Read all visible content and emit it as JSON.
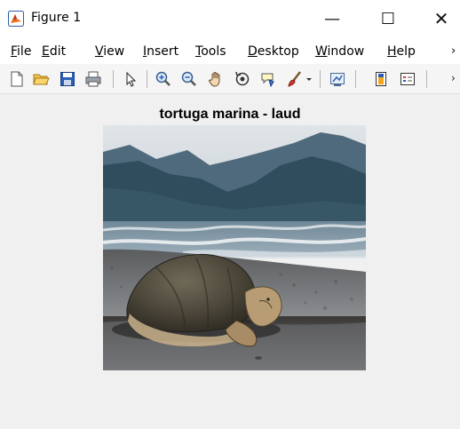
{
  "window": {
    "title": "Figure 1",
    "minimize_glyph": "—",
    "maximize_glyph": "☐",
    "close_glyph": "✕"
  },
  "menu": {
    "items": [
      {
        "accel": "F",
        "rest": "ile"
      },
      {
        "accel": "E",
        "rest": "dit"
      },
      {
        "accel": "V",
        "rest": "iew"
      },
      {
        "accel": "I",
        "rest": "nsert"
      },
      {
        "accel": "T",
        "rest": "ools"
      },
      {
        "accel": "D",
        "rest": "esktop"
      },
      {
        "accel": "W",
        "rest": "indow"
      },
      {
        "accel": "H",
        "rest": "elp"
      }
    ],
    "overflow": "›"
  },
  "toolbar": {
    "icons": [
      "new-figure-icon",
      "open-file-icon",
      "save-icon",
      "print-icon",
      "select-arrow-icon",
      "zoom-in-icon",
      "zoom-out-icon",
      "pan-hand-icon",
      "rotate-3d-icon",
      "data-cursor-icon",
      "brush-icon",
      "brush-dropdown-icon",
      "link-plot-icon",
      "colorbar-icon",
      "legend-icon"
    ],
    "overflow": "›"
  },
  "axes": {
    "title": "tortuga marina - laud"
  },
  "image": {
    "subject": "leatherback sea turtle on a beach with mountains"
  },
  "colors": {
    "titlebar_bg": "#ffffff",
    "figure_bg": "#f0f0f0",
    "matlab_icon_orange": "#e8742a"
  }
}
